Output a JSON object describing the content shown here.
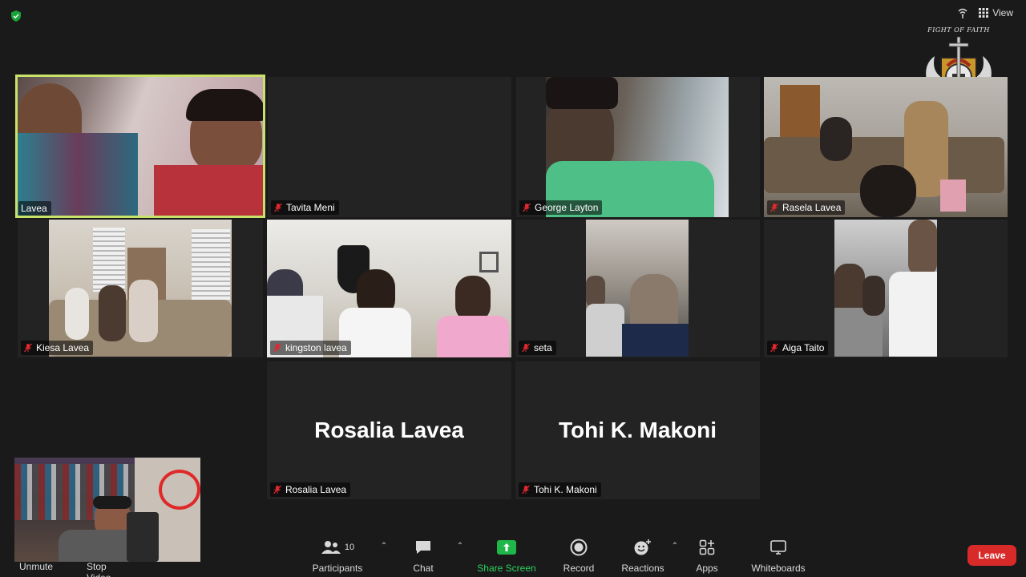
{
  "top_bar": {
    "view_label": "View"
  },
  "logo_text": "FIGHT OF FAITH",
  "participants": [
    {
      "display_name": "Lavea",
      "video": true,
      "active_speaker": true,
      "muted": false
    },
    {
      "display_name": "Tavita Meni",
      "video": false,
      "muted": true
    },
    {
      "display_name": "George Layton",
      "video": true,
      "muted": true
    },
    {
      "display_name": "Rasela Lavea",
      "video": true,
      "muted": true
    },
    {
      "display_name": "Kiesa Lavea",
      "video": true,
      "muted": true
    },
    {
      "display_name": "kingston lavea",
      "video": true,
      "muted": true
    },
    {
      "display_name": "seta",
      "video": true,
      "muted": true
    },
    {
      "display_name": "Aiga Taito",
      "video": true,
      "muted": true
    },
    {
      "display_name": "Rosalia Lavea",
      "big_name": "Rosalia Lavea",
      "video": false,
      "muted": true
    },
    {
      "display_name": "Tohi K. Makoni",
      "big_name": "Tohi K. Makoni",
      "video": false,
      "muted": true
    }
  ],
  "self_view": {
    "video": true
  },
  "bottom_left": {
    "unmute_label": "Unmute",
    "stop_video_label": "Stop Video"
  },
  "toolbar": {
    "participants_label": "Participants",
    "participants_count": "10",
    "chat_label": "Chat",
    "share_screen_label": "Share Screen",
    "record_label": "Record",
    "reactions_label": "Reactions",
    "apps_label": "Apps",
    "whiteboards_label": "Whiteboards"
  },
  "leave_label": "Leave",
  "colors": {
    "active_border": "#c8e26a",
    "share_green": "#1fb64a",
    "leave_red": "#d92a2a",
    "mute_red": "#e0282e"
  }
}
